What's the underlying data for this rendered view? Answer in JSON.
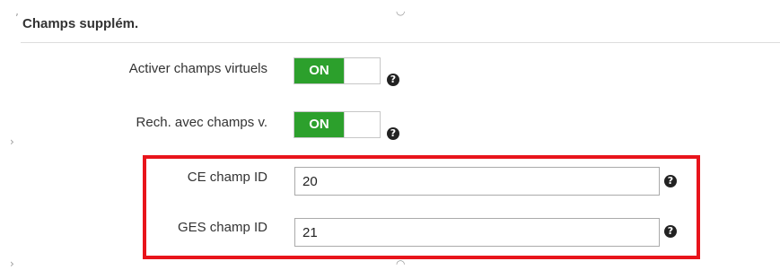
{
  "section": {
    "title": "Champs supplém."
  },
  "settings": {
    "virtual_fields": {
      "label": "Activer champs virtuels",
      "toggle_text": "ON"
    },
    "search_virtual_fields": {
      "label": "Rech. avec champs v.",
      "toggle_text": "ON"
    },
    "ce_field_id": {
      "label": "CE champ ID",
      "value": "20"
    },
    "ges_field_id": {
      "label": "GES champ ID",
      "value": "21"
    }
  },
  "icons": {
    "help": "?"
  },
  "colors": {
    "toggle_on": "#2ca02c",
    "highlight": "#e8141b",
    "divider": "#dddddd"
  }
}
